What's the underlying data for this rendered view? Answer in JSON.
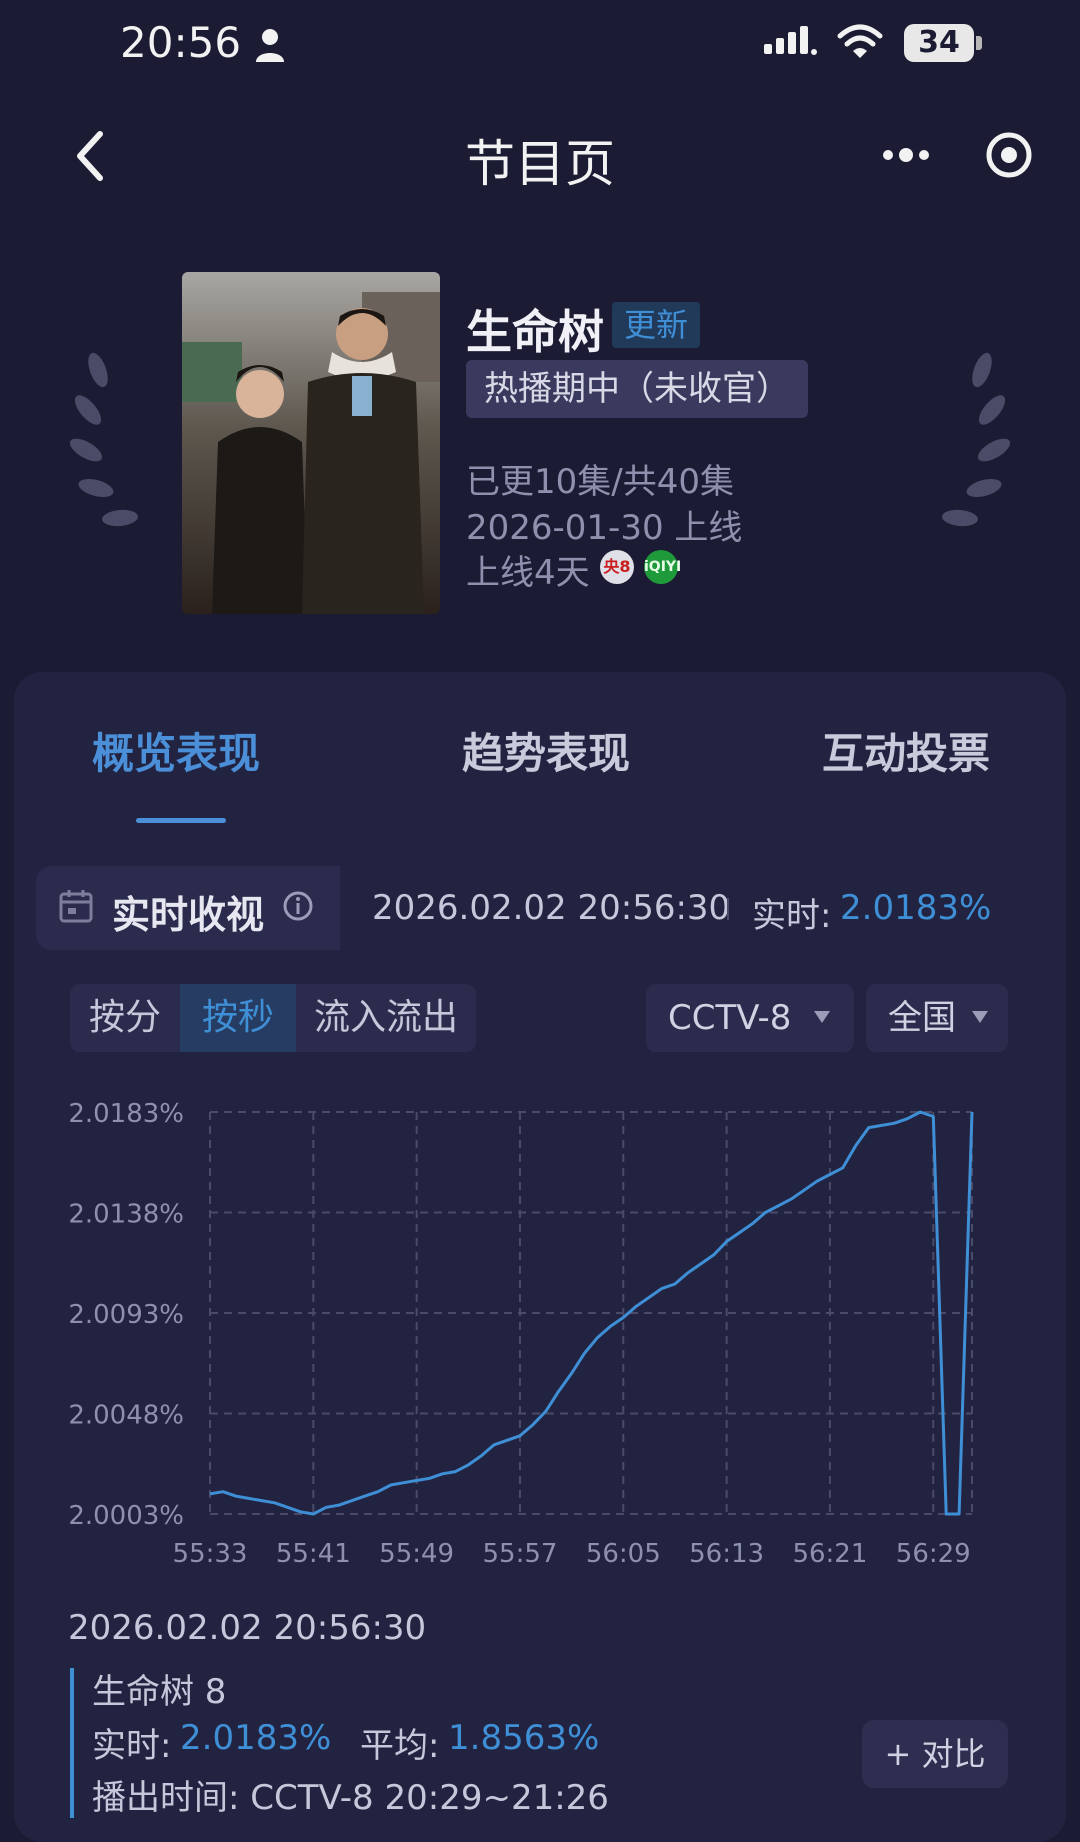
{
  "status_bar": {
    "time": "20:56",
    "battery": "34"
  },
  "nav": {
    "title": "节目页"
  },
  "program": {
    "name": "生命树",
    "update_badge": "更新",
    "status": "热播期中（未收官）",
    "episodes": "已更10集/共40集",
    "release": "2026-01-30 上线",
    "online_days": "上线4天",
    "poster_title": "生命树",
    "cctv_logo_text": "央8",
    "iqiyi_logo_text": "iQIYI"
  },
  "tabs": [
    {
      "label": "概览表现",
      "active": true
    },
    {
      "label": "趋势表现",
      "active": false
    },
    {
      "label": "互动投票",
      "active": false
    }
  ],
  "realtime": {
    "label": "实时收视",
    "timestamp": "2026.02.02 20:56:30",
    "prefix": "实时:",
    "value": "2.0183%"
  },
  "segments": [
    {
      "label": "按分",
      "active": false
    },
    {
      "label": "按秒",
      "active": true
    },
    {
      "label": "流入流出",
      "active": false
    }
  ],
  "filters": {
    "channel": "CCTV-8",
    "region": "全国"
  },
  "colors": {
    "accent": "#3f8fd6",
    "background": "#1b1c33",
    "card": "#222340"
  },
  "chart_data": {
    "type": "line",
    "y_tick_labels": [
      "2.0183%",
      "2.0138%",
      "2.0093%",
      "2.0048%",
      "2.0003%"
    ],
    "x_tick_labels": [
      "55:33",
      "55:41",
      "55:49",
      "55:57",
      "56:05",
      "56:13",
      "56:21",
      "56:29"
    ],
    "ylim": [
      2.0003,
      2.0183
    ],
    "grid": true,
    "series": [
      {
        "x": [
          "55:33",
          "55:34",
          "55:35",
          "55:36",
          "55:37",
          "55:38",
          "55:39",
          "55:40",
          "55:41",
          "55:42",
          "55:43",
          "55:44",
          "55:45",
          "55:46",
          "55:47",
          "55:48",
          "55:49",
          "55:50",
          "55:51",
          "55:52",
          "55:53",
          "55:54",
          "55:55",
          "55:56",
          "55:57",
          "55:58",
          "55:59",
          "56:00",
          "56:01",
          "56:02",
          "56:03",
          "56:04",
          "56:05",
          "56:06",
          "56:07",
          "56:08",
          "56:09",
          "56:10",
          "56:11",
          "56:12",
          "56:13",
          "56:14",
          "56:15",
          "56:16",
          "56:17",
          "56:18",
          "56:19",
          "56:20",
          "56:21",
          "56:22",
          "56:23",
          "56:24",
          "56:25",
          "56:26",
          "56:27",
          "56:28",
          "56:29",
          "56:30",
          "56:31",
          "56:32"
        ],
        "values": [
          2.0012,
          2.0013,
          2.0011,
          2.001,
          2.0009,
          2.0008,
          2.0006,
          2.0004,
          2.0003,
          2.0006,
          2.0007,
          2.0009,
          2.0011,
          2.0013,
          2.0016,
          2.0017,
          2.0018,
          2.0019,
          2.0021,
          2.0022,
          2.0025,
          2.0029,
          2.0034,
          2.0036,
          2.0038,
          2.0043,
          2.0049,
          2.0058,
          2.0066,
          2.0075,
          2.0082,
          2.0087,
          2.0091,
          2.0096,
          2.01,
          2.0104,
          2.0106,
          2.0111,
          2.0115,
          2.0119,
          2.0125,
          2.0129,
          2.0133,
          2.0138,
          2.0141,
          2.0144,
          2.0148,
          2.0152,
          2.0155,
          2.0158,
          2.0168,
          2.0176,
          2.0177,
          2.0178,
          2.018,
          2.0183,
          2.0181,
          2.0003,
          2.0003,
          2.0183
        ]
      }
    ]
  },
  "tooltip": {
    "time": "2026.02.02 20:56:30",
    "series_name": "生命树 8",
    "realtime_label": "实时:",
    "realtime_value": "2.0183%",
    "average_label": "平均:",
    "average_value": "1.8563%",
    "air_time": "播出时间:  CCTV-8 20:29~21:26"
  },
  "compare_button": "+ 对比"
}
